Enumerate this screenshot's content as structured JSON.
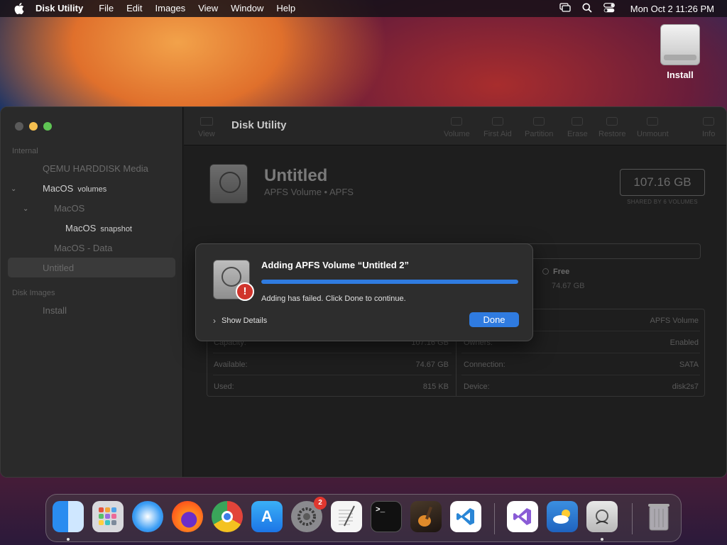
{
  "menubar": {
    "app_name": "Disk Utility",
    "items": [
      "File",
      "Edit",
      "Images",
      "View",
      "Window",
      "Help"
    ],
    "clock": "Mon Oct 2  11:26 PM"
  },
  "desktop": {
    "install_label": "Install"
  },
  "window": {
    "toolbar": {
      "title": "Disk Utility",
      "view_label": "View",
      "buttons": [
        "Volume",
        "First Aid",
        "Partition",
        "Erase",
        "Restore",
        "Unmount",
        "Info"
      ]
    },
    "sidebar": {
      "section_internal": "Internal",
      "items": [
        {
          "label": "QEMU HARDDISK Media",
          "sub": ""
        },
        {
          "label": "MacOS",
          "sub": "volumes"
        },
        {
          "label": "MacOS",
          "sub": ""
        },
        {
          "label": "MacOS",
          "sub": "snapshot"
        },
        {
          "label": "MacOS - Data",
          "sub": ""
        },
        {
          "label": "Untitled",
          "sub": ""
        }
      ],
      "section_disk_images": "Disk Images",
      "disk_images": [
        {
          "label": "Install"
        }
      ]
    },
    "volume": {
      "name": "Untitled",
      "subtitle": "APFS Volume • APFS",
      "capacity": "107.16 GB",
      "capacity_note": "SHARED BY 6 VOLUMES",
      "free_label": "Free",
      "free_value": "74.67 GB"
    },
    "info": {
      "left": [
        {
          "label": "Capacity:",
          "value": "107.16 GB"
        },
        {
          "label": "Available:",
          "value": "74.67 GB"
        },
        {
          "label": "Used:",
          "value": "815 KB"
        }
      ],
      "right": [
        {
          "label": "",
          "value": "APFS Volume"
        },
        {
          "label": "Owners:",
          "value": "Enabled"
        },
        {
          "label": "Connection:",
          "value": "SATA"
        },
        {
          "label": "Device:",
          "value": "disk2s7"
        }
      ]
    }
  },
  "sheet": {
    "title": "Adding APFS Volume “Untitled 2”",
    "message": "Adding has failed. Click Done to continue.",
    "show_details": "Show Details",
    "done_label": "Done",
    "progress": 1.0,
    "alert_glyph": "!"
  },
  "dock": {
    "apps": [
      "Finder",
      "Launchpad",
      "Safari",
      "Firefox",
      "Chrome",
      "App Store",
      "System Settings",
      "TextEdit",
      "Terminal",
      "GarageBand",
      "VS Code",
      "Visual Studio",
      "Weather",
      "Disk Utility",
      "Trash"
    ],
    "settings_badge": "2"
  },
  "colors": {
    "accent": "#2f7be0",
    "alert": "#d0342c"
  }
}
